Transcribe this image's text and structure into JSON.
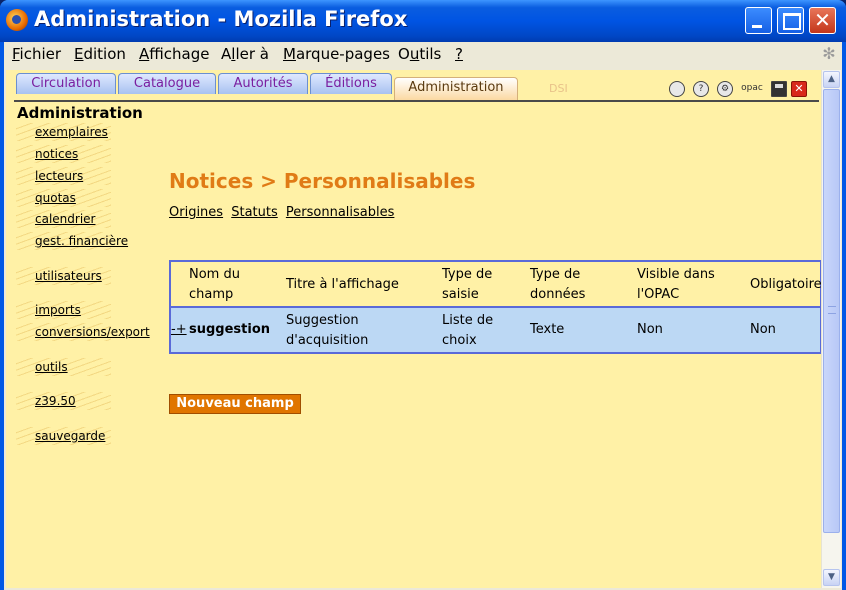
{
  "window": {
    "title": "Administration - Mozilla Firefox",
    "minimize": "",
    "maximize": "",
    "close": "✕"
  },
  "menubar": {
    "items": [
      {
        "u": "F",
        "rest": "ichier"
      },
      {
        "u": "E",
        "rest": "dition"
      },
      {
        "u": "A",
        "rest": "ffichage"
      },
      {
        "pre": "A",
        "u": "l",
        "rest": "ler à"
      },
      {
        "u": "M",
        "rest": "arque-pages"
      },
      {
        "pre": "O",
        "u": "u",
        "rest": "tils"
      },
      {
        "u": "?",
        "rest": ""
      }
    ]
  },
  "tabs": [
    {
      "label": "Circulation"
    },
    {
      "label": "Catalogue"
    },
    {
      "label": "Autorités"
    },
    {
      "label": "Éditions"
    },
    {
      "label": "Administration",
      "active": true
    }
  ],
  "ghost_text": "DSI",
  "toolbar_icons": {
    "opac": "opac",
    "help": "?",
    "close": "✕"
  },
  "sidebar": {
    "title": "Administration",
    "links": [
      "exemplaires",
      "notices",
      "lecteurs",
      "quotas",
      "calendrier",
      "gest. financière",
      "utilisateurs",
      "imports",
      "conversions/export",
      "outils",
      "z39.50",
      "sauvegarde"
    ]
  },
  "main": {
    "title": "Notices > Personnalisables",
    "subnav": [
      "Origines",
      "Statuts",
      "Personnalisables"
    ],
    "table": {
      "headers": [
        "Nom du\nchamp",
        "Titre à l'affichage",
        "Type de\nsaisie",
        "Type de\ndonnées",
        "Visible dans\nl'OPAC",
        "Obligatoire"
      ],
      "rows": [
        {
          "move": "-+",
          "name": "suggestion",
          "display": "Suggestion\nd'acquisition",
          "input_type": "Liste de\nchoix",
          "data_type": "Texte",
          "opac": "Non",
          "required": "Non"
        }
      ]
    },
    "new_button": "Nouveau champ"
  },
  "colors": {
    "page_bg": "#fff1a6",
    "title_orange": "#e07b16",
    "button_orange": "#e07500",
    "table_border": "#5a6ad8",
    "row_bg": "#bcd8f4"
  }
}
